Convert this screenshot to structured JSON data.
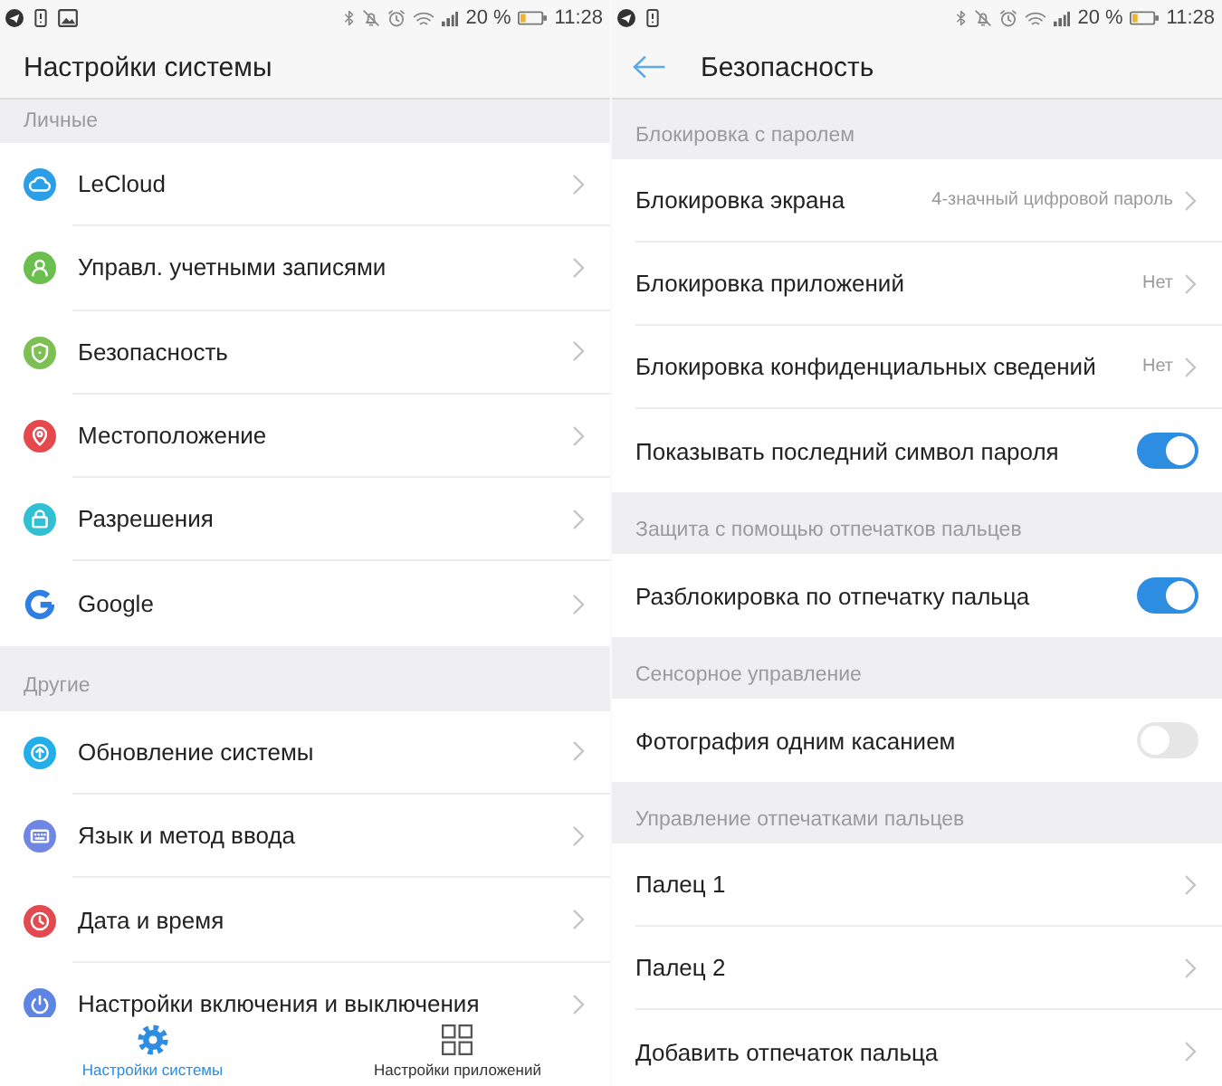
{
  "system_settings": {
    "status_bar": {
      "battery_percent": "20 %",
      "time": "11:28"
    },
    "title": "Настройки системы",
    "sections": [
      {
        "header": "Личные",
        "items": [
          {
            "label": "LeCloud",
            "color": "#2a9fe6"
          },
          {
            "label": "Управл. учетными записями",
            "color": "#6bbf4e"
          },
          {
            "label": "Безопасность",
            "color": "#7cbf52"
          },
          {
            "label": "Местоположение",
            "color": "#e5484d"
          },
          {
            "label": "Разрешения",
            "color": "#2fc0d4"
          },
          {
            "label": "Google",
            "color": "#2f7fe2"
          }
        ]
      },
      {
        "header": "Другие",
        "items": [
          {
            "label": "Обновление системы",
            "color": "#22aee8"
          },
          {
            "label": "Язык и метод ввода",
            "color": "#6f86e2"
          },
          {
            "label": "Дата и время",
            "color": "#e24a4f"
          },
          {
            "label": "Настройки включения и выключения",
            "color": "#5f85e4"
          }
        ]
      }
    ],
    "bottom_nav": [
      {
        "label": "Настройки системы",
        "selected": true
      },
      {
        "label": "Настройки приложений",
        "selected": false
      }
    ]
  },
  "security": {
    "status_bar": {
      "battery_percent": "20 %",
      "time": "11:28"
    },
    "title": "Безопасность",
    "sections": [
      {
        "header": "Блокировка с паролем",
        "items": [
          {
            "kind": "link",
            "label": "Блокировка экрана",
            "value": "4-значный цифровой пароль"
          },
          {
            "kind": "link",
            "label": "Блокировка приложений",
            "value": "Нет"
          },
          {
            "kind": "link",
            "label": "Блокировка конфиденциальных сведений",
            "value": "Нет"
          },
          {
            "kind": "switch",
            "label": "Показывать последний символ пароля",
            "on": true
          }
        ]
      },
      {
        "header": "Защита с помощью отпечатков пальцев",
        "items": [
          {
            "kind": "switch",
            "label": "Разблокировка по отпечатку пальца",
            "on": true
          }
        ]
      },
      {
        "header": "Сенсорное управление",
        "items": [
          {
            "kind": "switch",
            "label": "Фотография одним касанием",
            "on": false
          }
        ]
      },
      {
        "header": "Управление отпечатками пальцев",
        "items": [
          {
            "kind": "link",
            "label": "Палец 1"
          },
          {
            "kind": "link",
            "label": "Палец 2"
          },
          {
            "kind": "link",
            "label": "Добавить отпечаток пальца"
          }
        ]
      }
    ]
  }
}
